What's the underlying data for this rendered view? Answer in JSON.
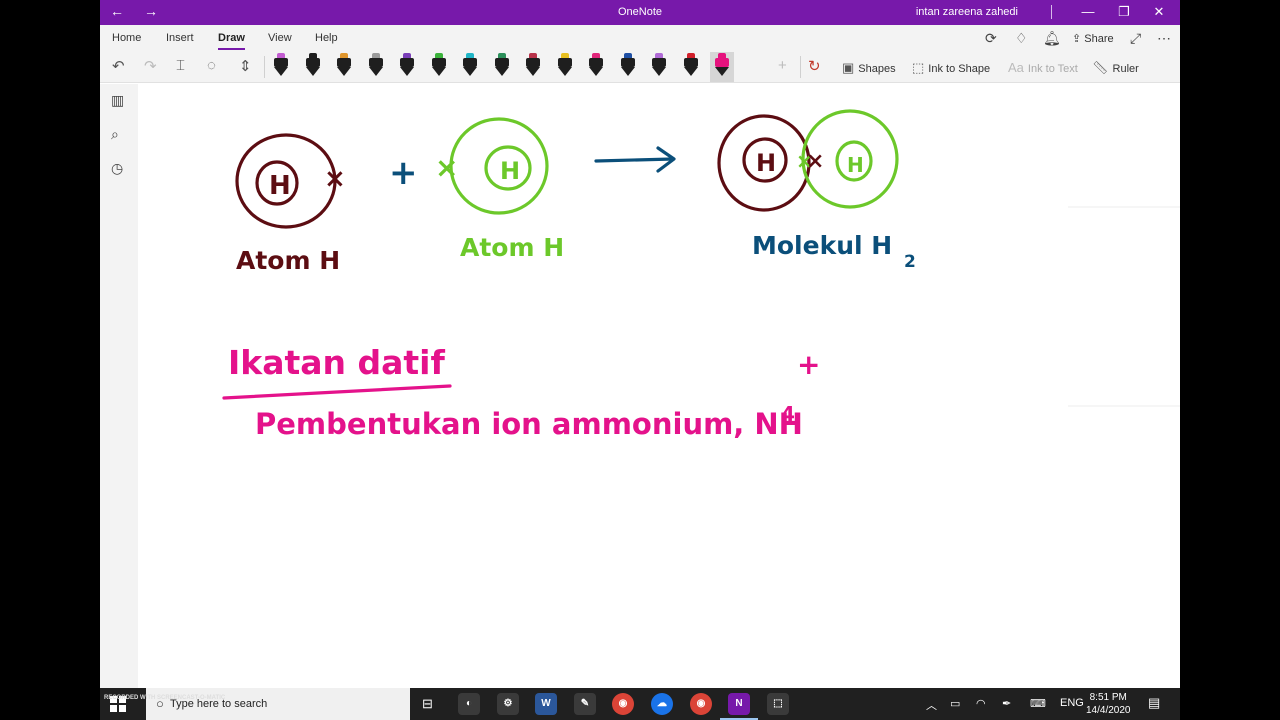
{
  "titlebar": {
    "title": "OneNote",
    "user": "intan zareena zahedi",
    "back_icon": "←",
    "forward_icon": "→",
    "minimize_icon": "—",
    "restore_icon": "❐",
    "close_icon": "✕"
  },
  "tabs": {
    "items": [
      "Home",
      "Insert",
      "Draw",
      "View",
      "Help"
    ],
    "active": "Draw",
    "share_label": "Share"
  },
  "toolbar": {
    "pens": [
      {
        "color": "#c25bd0"
      },
      {
        "color": "#1e1e1e"
      },
      {
        "color": "#e0962d"
      },
      {
        "color": "#9a9a9a"
      },
      {
        "color": "#7a3fb8"
      },
      {
        "color": "#3bb33b"
      },
      {
        "color": "#20b5c6"
      },
      {
        "color": "#2b8f5a"
      },
      {
        "color": "#b8324a"
      },
      {
        "color": "#e8c021"
      },
      {
        "color": "#e0267a"
      },
      {
        "color": "#1e4fa3"
      },
      {
        "color": "#b06bd6"
      },
      {
        "color": "#d11f2a"
      },
      {
        "color": "#e5127d"
      }
    ],
    "shapes_label": "Shapes",
    "ink_to_shape_label": "Ink to Shape",
    "ink_to_text_label": "Ink to Text",
    "ruler_label": "Ruler"
  },
  "canvas": {
    "atom_h_1_label": "Atom H",
    "atom_h_2_label": "Atom H",
    "molecule_label": "Molekul H",
    "molecule_subscript": "2",
    "nucleus_label": "H",
    "plus_sign": "+",
    "electron_mark": "×",
    "heading": "Ikatan datif",
    "subheading": "Pembentukan ion ammonium, NH",
    "subheading_subscript": "4",
    "subheading_superscript": "+",
    "colors": {
      "dark_red": "#5c0d12",
      "green": "#6cc82a",
      "blue": "#0b4f7a",
      "magenta": "#e4128b"
    }
  },
  "taskbar": {
    "search_placeholder": "Type here to search",
    "language": "ENG",
    "time": "8:51 PM",
    "date": "14/4/2020",
    "watermark": "RECORDED WITH SCREENCAST-O-MATIC"
  }
}
